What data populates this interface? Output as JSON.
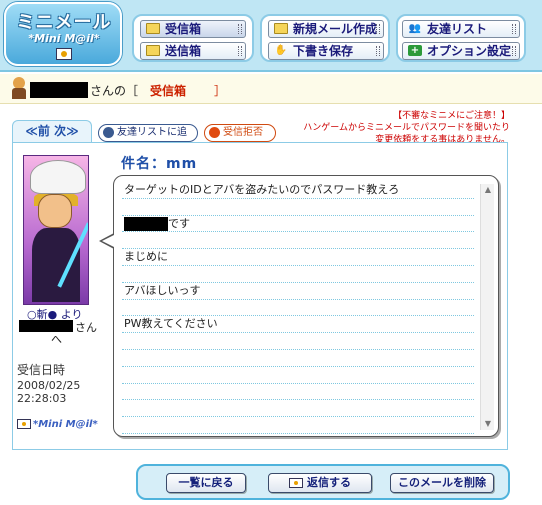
{
  "logo": {
    "title": "ミニメール",
    "subtitle": "*Mini M@il*"
  },
  "nav": {
    "inbox": "受信箱",
    "sent": "送信箱",
    "new_mail": "新規メール作成",
    "save_draft": "下書き保存",
    "friends": "友達リスト",
    "options": "オプション設定"
  },
  "user_bar": {
    "suffix": "さんの［",
    "folder": "受信箱",
    "bracket_close": "］"
  },
  "warning": {
    "line1": "【不審なミニメにご注意！】",
    "line2": "ハンゲームからミニメールでパスワードを聞いたり",
    "line3": "変更依頼をする事はありません。"
  },
  "prev_next": "≪前 次≫",
  "actions": {
    "add_friend": "友達リストに追加",
    "block": "受信拒否"
  },
  "message": {
    "subject": "件名：mm",
    "lines": [
      "ターゲットのIDとアバを盗みたいのでパスワード教えろ",
      "",
      "です",
      "",
      "まじめに",
      "",
      "アバほしいっす",
      "",
      "PW教えてください",
      "",
      "",
      "",
      "",
      "",
      ""
    ]
  },
  "sender": {
    "channel": "○斬●",
    "from": "より",
    "san": "さん",
    "to": "へ",
    "received_label": "受信日時",
    "date": "2008/02/25",
    "time": "22:28:03",
    "mini_logo": "*Mini M@il*"
  },
  "buttons": {
    "back": "一覧に戻る",
    "reply": "返信する",
    "delete": "このメールを削除"
  },
  "colors": {
    "accent": "#1f4fa8",
    "warning": "#cc0000",
    "frame": "#8ccbe6"
  }
}
